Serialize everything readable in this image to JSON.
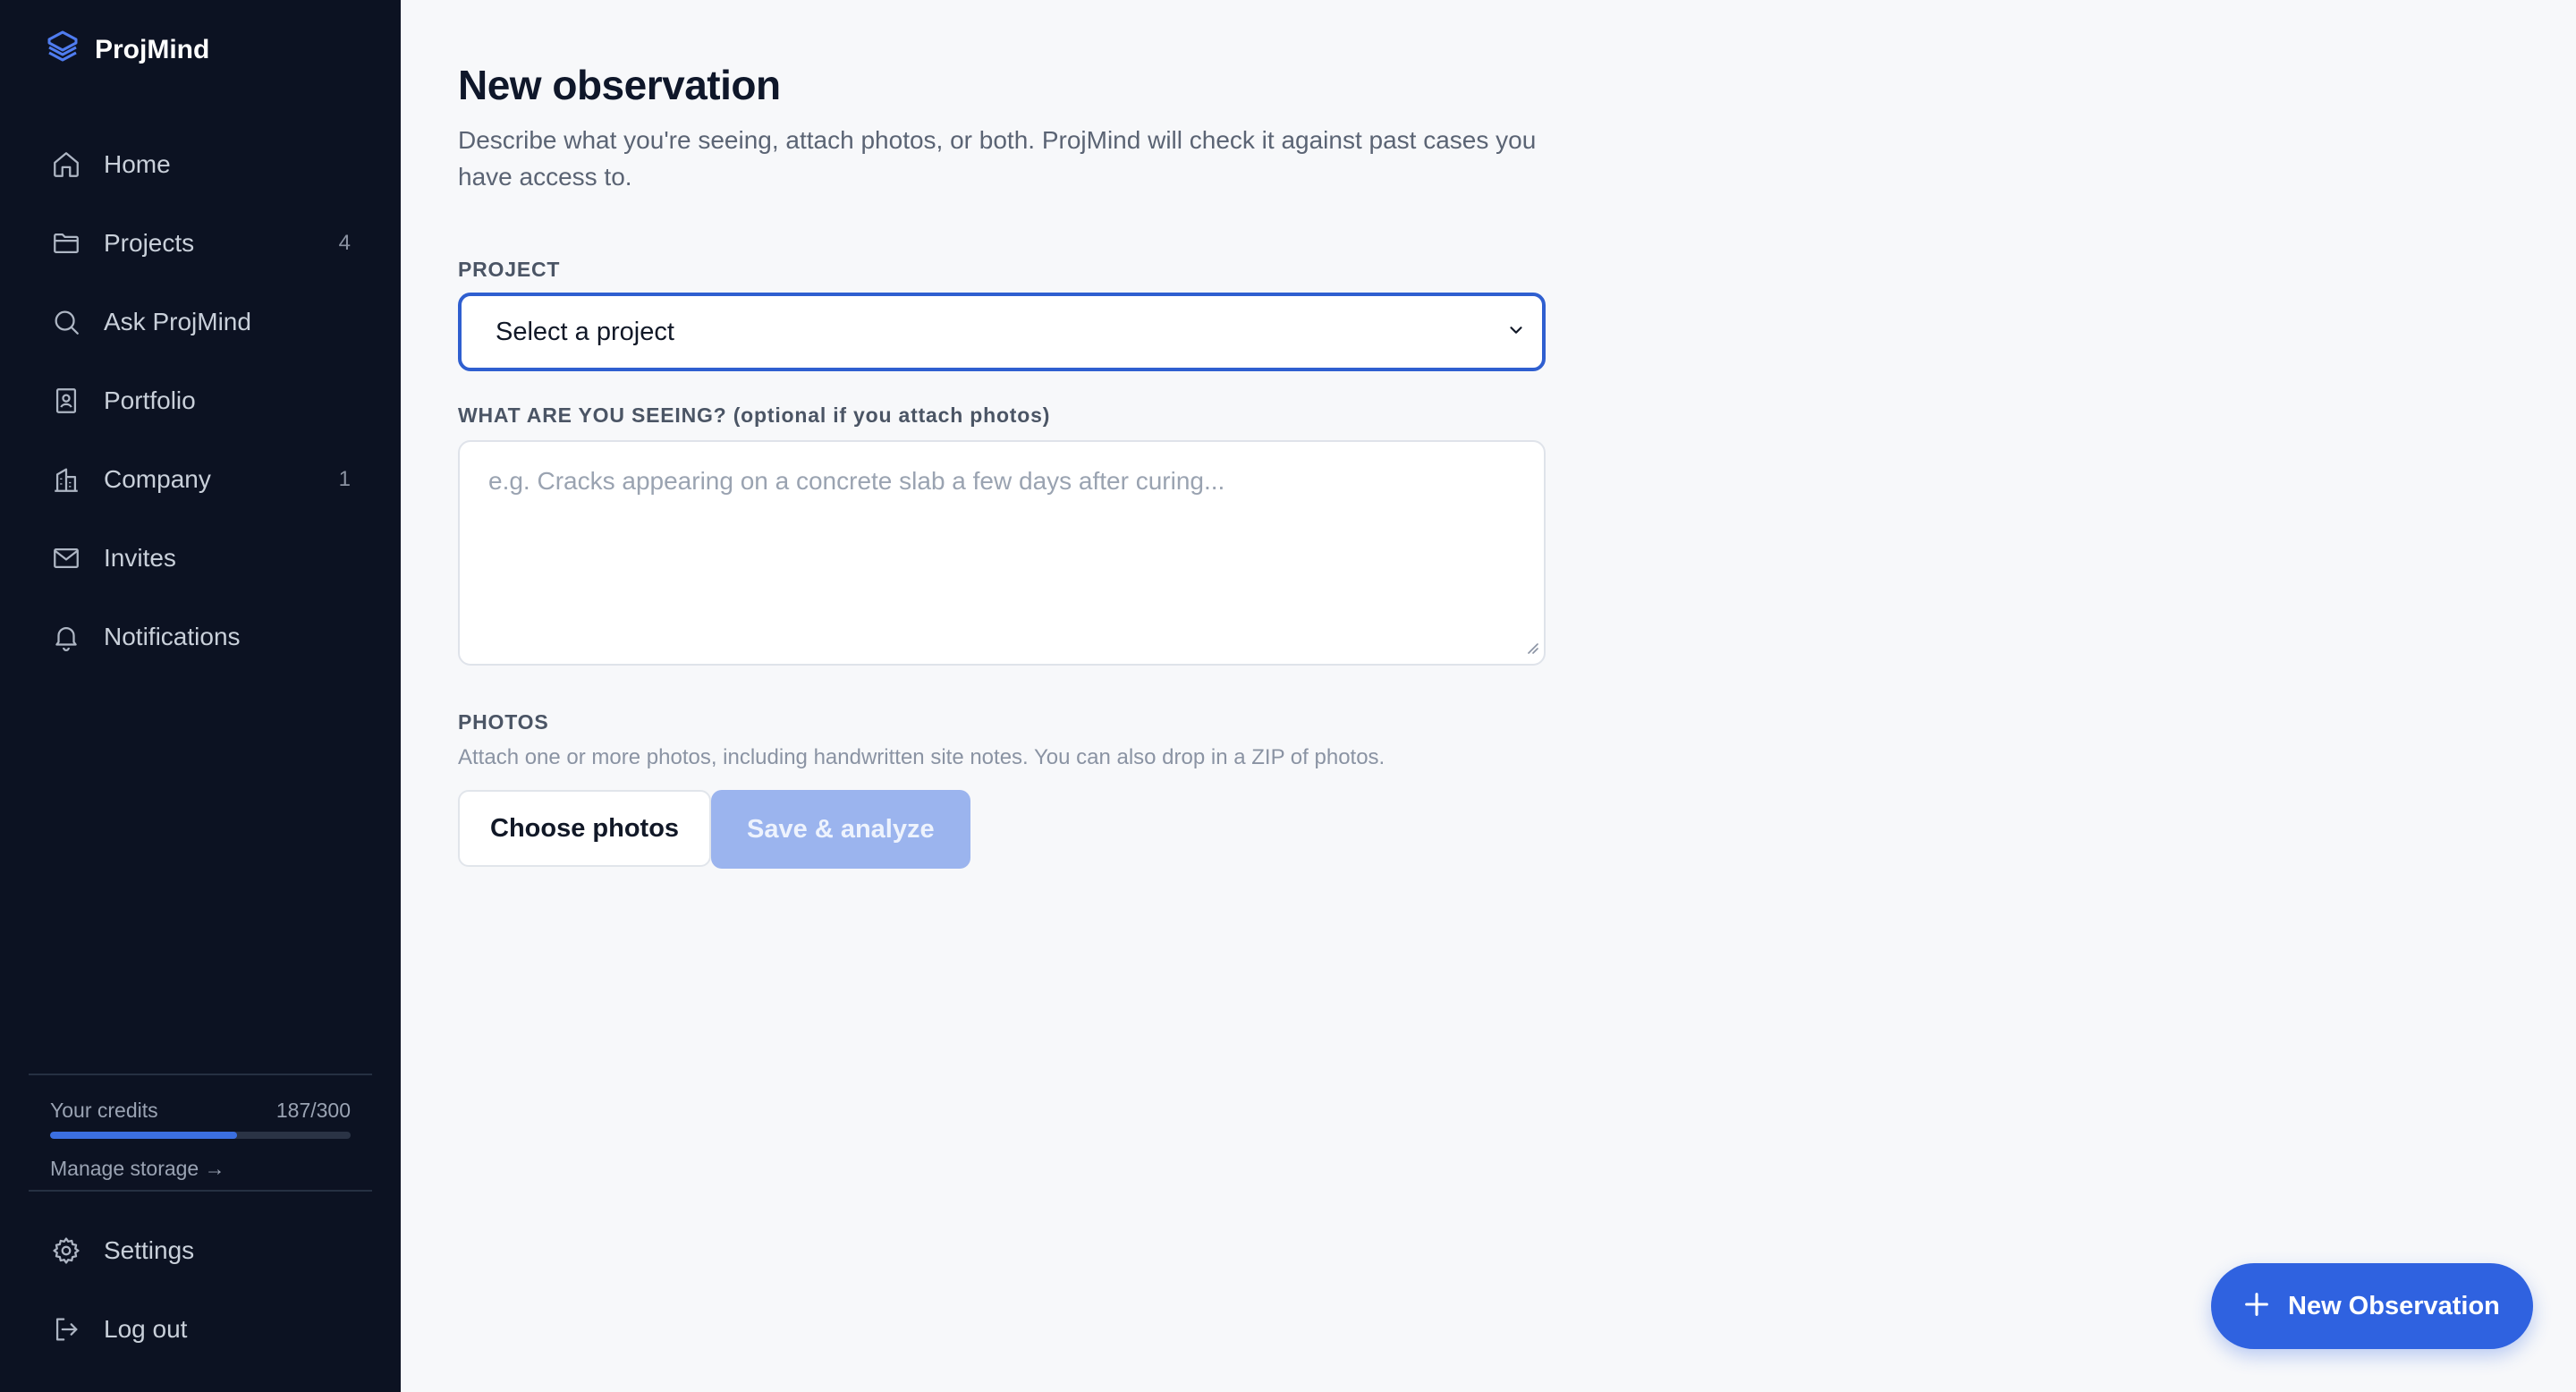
{
  "app": {
    "name": "ProjMind",
    "accent": "#2f62e0",
    "sidebar_bg": "#0c1222"
  },
  "sidebar": {
    "items": [
      {
        "label": "Home",
        "icon": "home-icon",
        "count": ""
      },
      {
        "label": "Projects",
        "icon": "folder-icon",
        "count": "4"
      },
      {
        "label": "Ask ProjMind",
        "icon": "search-icon",
        "count": ""
      },
      {
        "label": "Portfolio",
        "icon": "portfolio-icon",
        "count": ""
      },
      {
        "label": "Company",
        "icon": "building-icon",
        "count": "1"
      },
      {
        "label": "Invites",
        "icon": "mail-icon",
        "count": ""
      },
      {
        "label": "Notifications",
        "icon": "bell-icon",
        "count": ""
      }
    ],
    "credits": {
      "label": "Your credits",
      "value": "187/300",
      "used": 187,
      "total": 300
    },
    "manage_storage": "Manage storage →",
    "bottom_items": [
      {
        "label": "Settings",
        "icon": "gear-icon"
      },
      {
        "label": "Log out",
        "icon": "logout-icon"
      }
    ]
  },
  "main": {
    "title": "New observation",
    "subtitle": "Describe what you're seeing, attach photos, or both. ProjMind will check it against past cases you have access to.",
    "project": {
      "label": "PROJECT",
      "selected": "Select a project"
    },
    "seeing": {
      "label": "WHAT ARE YOU SEEING? (optional if you attach photos)",
      "placeholder": "e.g. Cracks appearing on a concrete slab a few days after curing...",
      "value": ""
    },
    "photos": {
      "label": "PHOTOS",
      "hint": "Attach one or more photos, including handwritten site notes. You can also drop in a ZIP of photos.",
      "choose_label": "Choose photos",
      "save_label": "Save & analyze"
    }
  },
  "fab": {
    "label": "New Observation",
    "icon": "plus-icon"
  }
}
